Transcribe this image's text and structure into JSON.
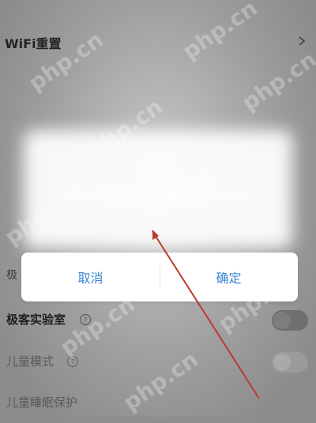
{
  "header": {
    "title": "WiFi重置"
  },
  "dialog": {
    "cancel_label": "取消",
    "confirm_label": "确定"
  },
  "background_label_partial": "极",
  "settings": [
    {
      "label": "极客实验室"
    },
    {
      "label": "儿童模式"
    },
    {
      "label": "儿童睡眠保护"
    }
  ],
  "watermark_text": "php.cn",
  "colors": {
    "accent": "#3c86d4",
    "arrow": "#c0392b"
  }
}
